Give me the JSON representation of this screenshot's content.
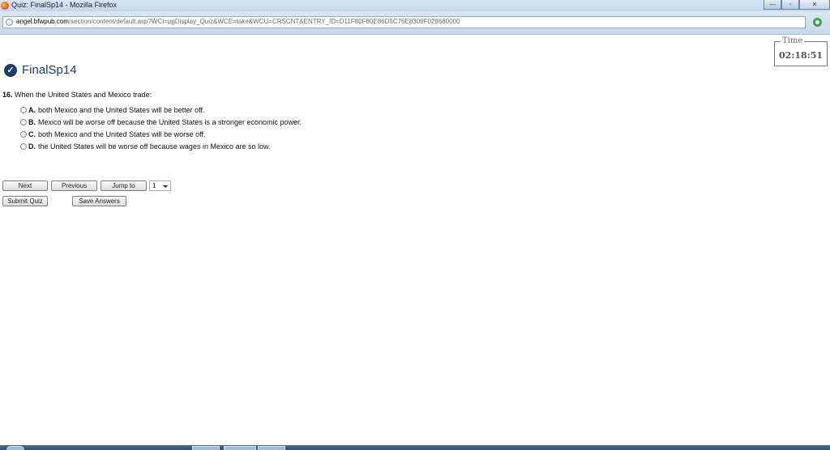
{
  "window": {
    "title": "Quiz: FinalSp14 - Mozilla Firefox",
    "min_label": "—",
    "restore_label": "▫",
    "close_label": "✕"
  },
  "urlbar": {
    "domain": "angel.bfwpub.com",
    "path": "/section/content/default.asp?WCI=pgDisplay_Quiz&WCE=take&WCU=CRSCNT&ENTRY_ID=D11F80F80E86D5C76E8309F028680000"
  },
  "timer": {
    "label": "Time",
    "value": "02:18:51"
  },
  "quiz": {
    "name": "FinalSp14",
    "check": "✓"
  },
  "question": {
    "number": "16.",
    "text": "When the United States and Mexico trade:",
    "options": [
      {
        "letter": "A.",
        "text": "both Mexico and the United States will be better off."
      },
      {
        "letter": "B.",
        "text": "Mexico will be worse off because the United States is a stronger economic power."
      },
      {
        "letter": "C.",
        "text": "both Mexico and the United States will be worse off."
      },
      {
        "letter": "D.",
        "text": "the United States will be worse off because wages in Mexico are so low."
      }
    ]
  },
  "nav": {
    "next": "Next",
    "previous": "Previous",
    "jump_to": "Jump to",
    "jump_value": "1",
    "submit": "Submit Quiz",
    "save": "Save Answers"
  }
}
